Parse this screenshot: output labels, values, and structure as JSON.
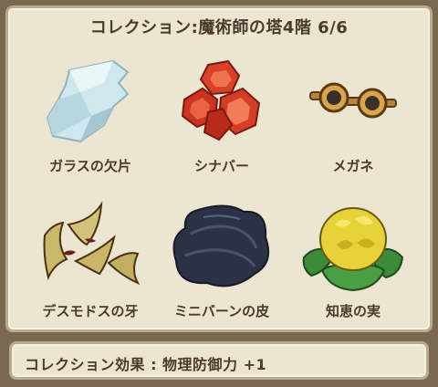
{
  "collection": {
    "title": "コレクション:魔術師の塔4階 6/6",
    "effect": "コレクション効果 : 物理防御力 +1"
  },
  "items": [
    {
      "name": "ガラスの欠片",
      "icon": "glass-shard-icon"
    },
    {
      "name": "シナバー",
      "icon": "cinnabar-icon"
    },
    {
      "name": "メガネ",
      "icon": "glasses-icon"
    },
    {
      "name": "デスモドスの牙",
      "icon": "fang-icon"
    },
    {
      "name": "ミニバーンの皮",
      "icon": "hide-icon"
    },
    {
      "name": "知恵の実",
      "icon": "wisdom-fruit-icon"
    }
  ],
  "colors": {
    "panel_bg": "#ece5d0",
    "border": "#b9ab8c",
    "text": "#4a3a2c"
  }
}
